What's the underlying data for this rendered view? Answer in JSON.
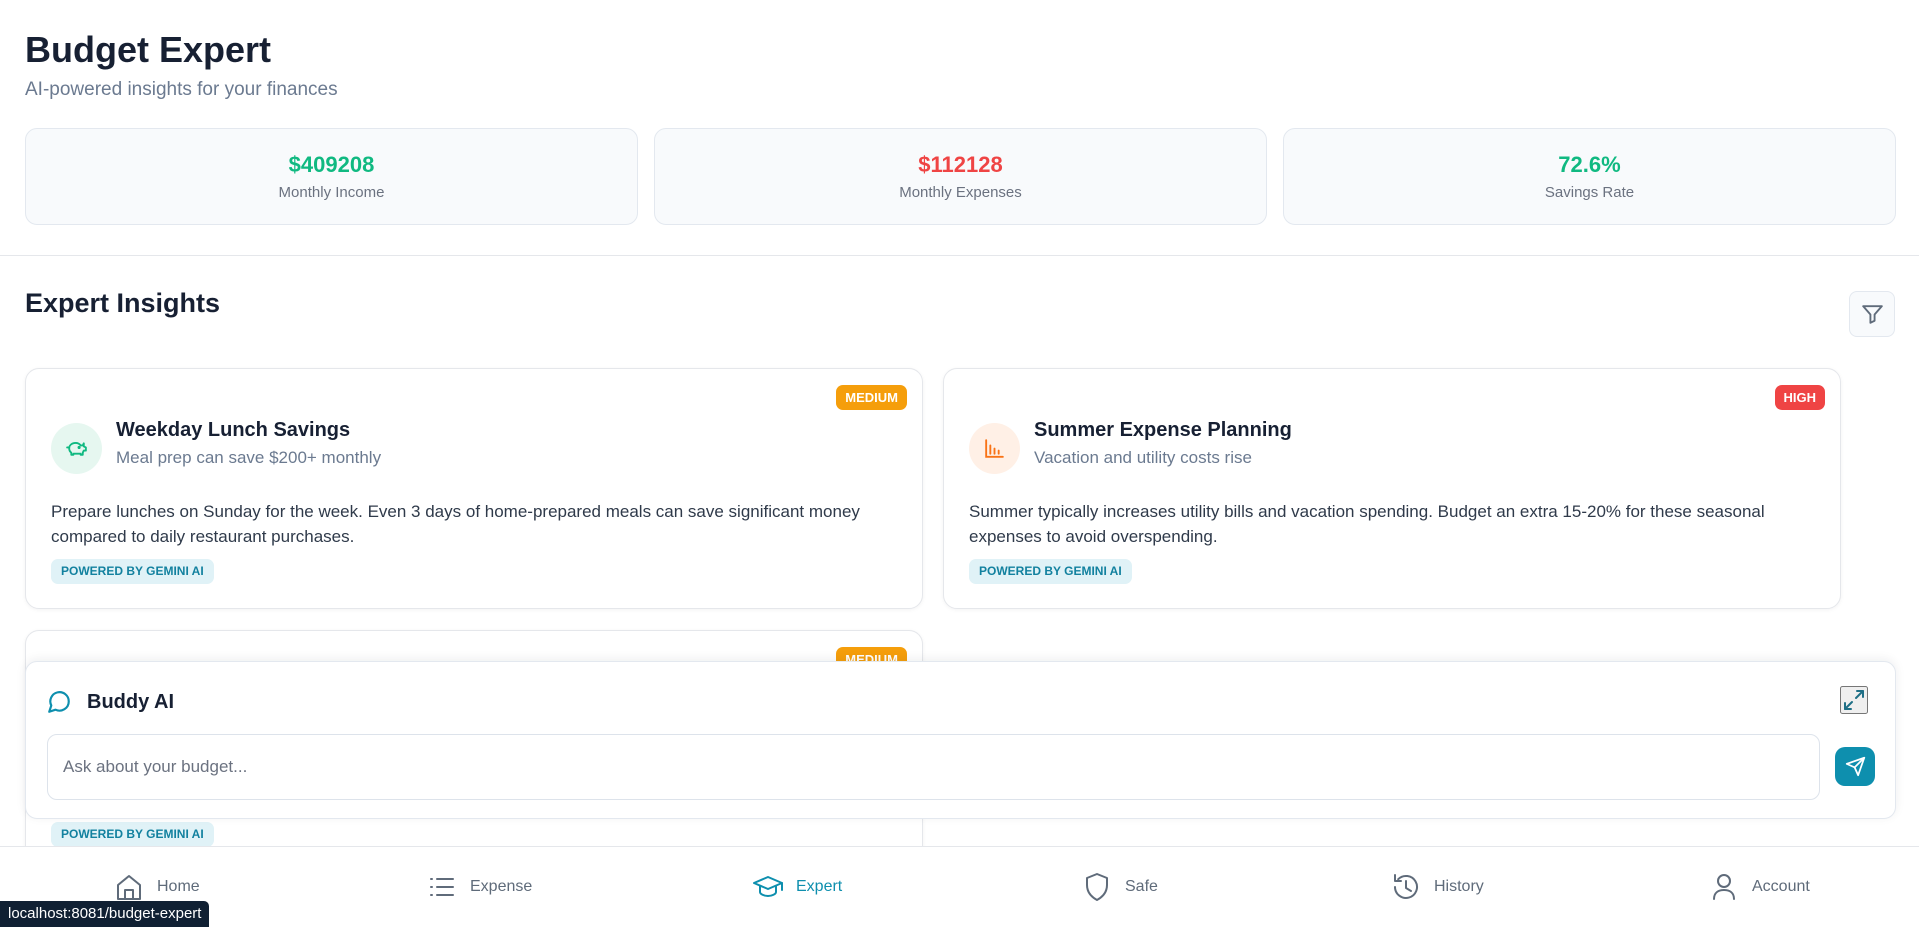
{
  "header": {
    "title": "Budget Expert",
    "subtitle": "AI-powered insights for your finances"
  },
  "stats": [
    {
      "value": "$409208",
      "label": "Monthly Income",
      "color": "#10b981"
    },
    {
      "value": "$112128",
      "label": "Monthly Expenses",
      "color": "#ef4444"
    },
    {
      "value": "72.6%",
      "label": "Savings Rate",
      "color": "#10b981"
    }
  ],
  "insights": {
    "title": "Expert Insights",
    "filter_icon": "filter-icon",
    "items": [
      {
        "priority": "MEDIUM",
        "title": "Weekday Lunch Savings",
        "subtitle": "Meal prep can save $200+ monthly",
        "body": "Prepare lunches on Sunday for the week. Even 3 days of home-prepared meals can save significant money compared to daily restaurant purchases.",
        "tag": "POWERED BY GEMINI AI",
        "icon": "piggy-bank-icon"
      },
      {
        "priority": "HIGH",
        "title": "Summer Expense Planning",
        "subtitle": "Vacation and utility costs rise",
        "body": "Summer typically increases utility bills and vacation spending. Budget an extra 15-20% for these seasonal expenses to avoid overspending.",
        "tag": "POWERED BY GEMINI AI",
        "icon": "chart-icon"
      },
      {
        "priority": "MEDIUM",
        "tag": "POWERED BY GEMINI AI"
      }
    ]
  },
  "chat": {
    "title": "Buddy AI",
    "placeholder": "Ask about your budget...",
    "value": ""
  },
  "nav": {
    "items": [
      {
        "label": "Home",
        "icon": "home-icon"
      },
      {
        "label": "Expense",
        "icon": "list-icon"
      },
      {
        "label": "Expert",
        "icon": "graduation-cap-icon",
        "active": true
      },
      {
        "label": "Safe",
        "icon": "shield-icon"
      },
      {
        "label": "History",
        "icon": "history-icon"
      },
      {
        "label": "Account",
        "icon": "user-icon"
      }
    ]
  },
  "status_bar": {
    "url": "localhost:8081/budget-expert"
  }
}
